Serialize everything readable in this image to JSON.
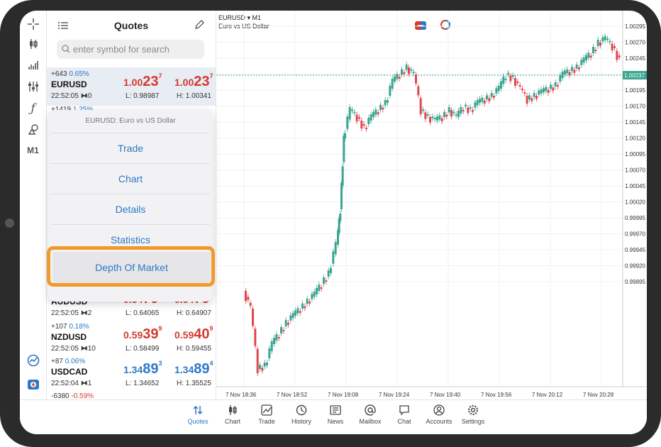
{
  "quotes_title": "Quotes",
  "search_placeholder": "enter symbol for search",
  "toolbar": {
    "timeframe": "M1"
  },
  "rows": [
    {
      "change_pts": "+643",
      "change_pct": "0.65%",
      "symbol": "EURUSD",
      "time": "22:52:05",
      "spread": "0",
      "bid_main": "1.00",
      "bid_big": "23",
      "bid_sup": "7",
      "ask_main": "1.00",
      "ask_big": "23",
      "ask_sup": "7",
      "low": "L: 0.98987",
      "high": "H: 1.00341"
    },
    {
      "change_pts": "+1419",
      "change_pct": "1.25%"
    },
    {
      "symbol": "AUDUSD",
      "time": "22:52:05",
      "spread": "2",
      "bid_main": "0.64",
      "bid_big": "79",
      "bid_sup": "2",
      "ask_main": "0.64",
      "ask_big": "79",
      "ask_sup": "4",
      "low": "L: 0.64065",
      "high": "H: 0.64907"
    },
    {
      "change_pts": "+107",
      "change_pct": "0.18%",
      "symbol": "NZDUSD",
      "time": "22:52:05",
      "spread": "10",
      "bid_main": "0.59",
      "bid_big": "39",
      "bid_sup": "9",
      "ask_main": "0.59",
      "ask_big": "40",
      "ask_sup": "9",
      "low": "L: 0.58499",
      "high": "H: 0.59455"
    },
    {
      "change_pts": "+87",
      "change_pct": "0.06%",
      "symbol": "USDCAD",
      "time": "22:52:04",
      "spread": "1",
      "bid_main": "1.34",
      "bid_big": "89",
      "bid_sup": "3",
      "ask_main": "1.34",
      "ask_big": "89",
      "ask_sup": "4",
      "low": "L: 1.34652",
      "high": "H: 1.35525"
    },
    {
      "change_pts": "-6380",
      "change_pct": "-0.59%"
    }
  ],
  "menu": {
    "title": "EURUSD: Euro vs US Dollar",
    "items": [
      "Trade",
      "Chart",
      "Details",
      "Statistics",
      "Depth Of Market"
    ]
  },
  "chart": {
    "symbol_line": "EURUSD ▾ M1",
    "description": "Euro vs US Dollar",
    "current_price": "1.00237",
    "price_labels": [
      "1.00295",
      "1.00270",
      "1.00245",
      "1.00220",
      "1.00195",
      "1.00170",
      "1.00145",
      "1.00120",
      "1.00095",
      "1.00070",
      "1.00045",
      "1.00020",
      "0.99995",
      "0.99970",
      "0.99945",
      "0.99920",
      "0.99895"
    ],
    "time_labels": [
      "7 Nov 18:36",
      "7 Nov 18:52",
      "7 Nov 19:08",
      "7 Nov 19:24",
      "7 Nov 19:40",
      "7 Nov 19:56",
      "7 Nov 20:12",
      "7 Nov 20:28"
    ],
    "bull_color": "#3aa58f",
    "bear_color": "#e0474c"
  },
  "nav": [
    "Quotes",
    "Chart",
    "Trade",
    "History",
    "News",
    "Mailbox",
    "Chat",
    "Accounts",
    "Settings"
  ],
  "colors": {
    "accent": "#2d79c7",
    "highlight": "#f19a2c",
    "price_red": "#d23b30"
  }
}
